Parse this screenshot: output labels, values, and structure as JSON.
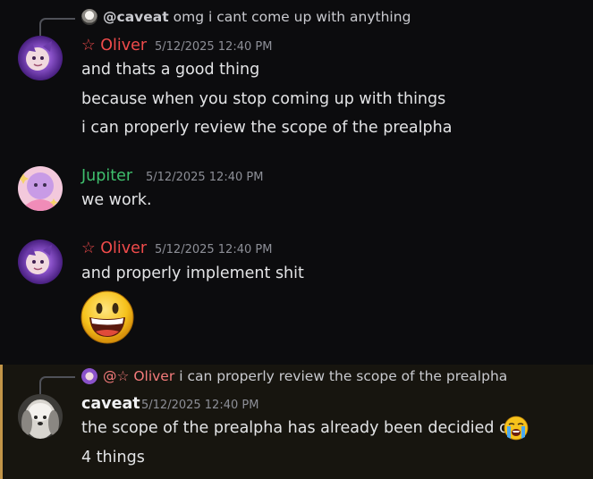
{
  "colors": {
    "background": "#0c0c0e",
    "oliver": "#f04b4b",
    "jupiter": "#3fbf6d",
    "caveat": "#f0f1f3",
    "mention": "#f47b7b",
    "highlight": "#17150f",
    "highlight_bar": "#c29548"
  },
  "messages": [
    {
      "reply": {
        "author": "@caveat",
        "text": "omg i cant come up with anything",
        "avatar_icon": "dog-avatar-icon"
      },
      "author": "☆ Oliver",
      "timestamp": "5/12/2025 12:40 PM",
      "avatar_icon": "purple-cat-avatar-icon",
      "lines": [
        "and thats a good thing",
        "because when you stop coming up with things",
        "i can properly review the scope of the prealpha"
      ]
    },
    {
      "author": "Jupiter",
      "timestamp": "5/12/2025 12:40 PM",
      "avatar_icon": "pink-character-avatar-icon",
      "lines": [
        "we work."
      ]
    },
    {
      "author": "☆ Oliver",
      "timestamp": "5/12/2025 12:40 PM",
      "avatar_icon": "purple-cat-avatar-icon",
      "lines": [
        "and properly implement shit"
      ],
      "emoji": "grinning-face-emoji"
    },
    {
      "reply": {
        "author": "@☆ Oliver",
        "text": "i can properly review the scope of the prealpha",
        "avatar_icon": "purple-cat-avatar-icon"
      },
      "author": "caveat",
      "timestamp": "5/12/2025 12:40 PM",
      "avatar_icon": "dog-avatar-icon",
      "lines": [
        "the scope of the prealpha has already been decidied on",
        "4 things"
      ],
      "emoji": "loudly-crying-face-emoji"
    }
  ]
}
